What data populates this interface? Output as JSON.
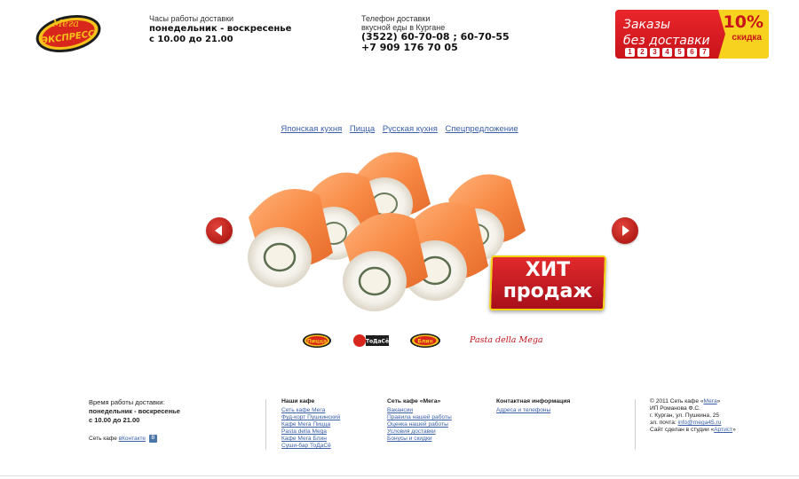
{
  "header": {
    "logo_text_top": "Мега",
    "logo_text_main": "ЭКСПРЕСС",
    "hours": {
      "label": "Часы работы доставки",
      "days": "понедельник - воскресенье",
      "time": "с 10.00 до 21.00"
    },
    "phone": {
      "label_1": "Телефон доставки",
      "label_2": "вкусной еды в Кургане",
      "line_1": "(3522) 60-70-08 ; 60-70-55",
      "line_2": "+7 909 176 70 05"
    },
    "promo": {
      "line_1": "Заказы",
      "line_2": "без доставки",
      "digits": [
        "1",
        "2",
        "3",
        "4",
        "5",
        "6",
        "7"
      ],
      "percent": "10%",
      "discount": "скидка"
    }
  },
  "menu": {
    "items": [
      "Японская кухня",
      "Пицца",
      "Русская кухня",
      "Спецпредложение"
    ]
  },
  "slider": {
    "badge_line_1": "ХИТ",
    "badge_line_2": "продаж"
  },
  "partners": {
    "logo_a": "Пицца",
    "logo_b": "ТоДаСё",
    "logo_c": "Блин",
    "logo_d": "Pasta della Mega"
  },
  "footer": {
    "col1": {
      "label": "Время работы доставки:",
      "days": "понедельник - воскресенье",
      "time": "с 10.00 до 21.00",
      "social_prefix": "Сеть кафе",
      "social_link": "вКонтакте",
      "social_badge": "В"
    },
    "col2": {
      "title": "Наши кафе",
      "links": [
        "Сеть кафе Мега",
        "Фуд-корт Пушкинский",
        "Кафе Мега Пицца",
        "Pasta della Mega",
        "Кафе Мега Блин",
        "Суши-бар ТоДаСё"
      ]
    },
    "col3": {
      "title": "Сеть кафе «Мега»",
      "links": [
        "Вакансии",
        "Правила нашей работы",
        "Оценка нашей работы",
        "Условия доставки",
        "Бонусы и скидки"
      ]
    },
    "col4": {
      "title": "Контактная информация",
      "links": [
        "Адреса и телефоны"
      ]
    },
    "col5": {
      "copyright_prefix": "© 2011 Сеть кафе «",
      "copyright_link": "Мега",
      "copyright_suffix": "»",
      "owner": "ИП Романова Ф.С.",
      "address": "г. Курган, ул. Пушкина, 25",
      "email_label": "эл. почта: ",
      "email": "info@mega45.ru",
      "studio_prefix": "Сайт сделан в студии «",
      "studio_link": "Артист",
      "studio_suffix": "»"
    }
  }
}
